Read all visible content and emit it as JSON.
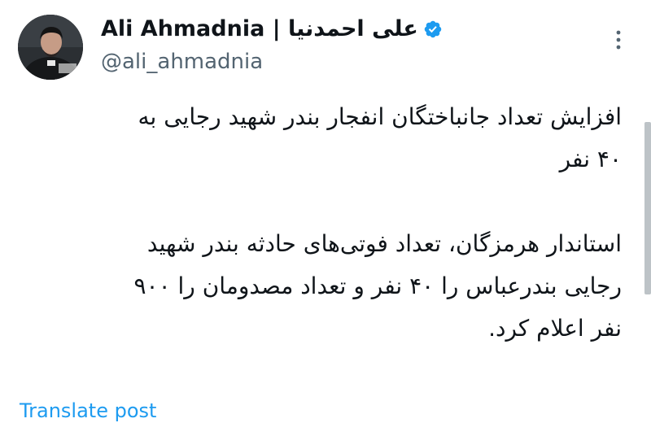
{
  "author": {
    "display_name": "Ali Ahmadnia | علی احمدنیا",
    "handle": "@ali_ahmadnia",
    "verified_color": "#1d9bf0"
  },
  "menu": {
    "more_icon": "more-vertical-icon"
  },
  "post": {
    "paragraphs": [
      {
        "lines": [
          "افزایش تعداد جانباختگان انفجار بندر شهید رجایی به",
          "۴۰ نفر"
        ]
      },
      {
        "lines": [
          "استاندار هرمزگان، تعداد فوتی‌های حادثه بندر شهید",
          "رجایی بندرعباس را ۴۰ نفر و تعداد مصدومان را ۹۰۰",
          "نفر اعلام کرد."
        ]
      }
    ]
  },
  "actions": {
    "translate_label": "Translate post"
  },
  "colors": {
    "text": "#0f1419",
    "secondary_text": "#536471",
    "link": "#1d9bf0",
    "background": "#ffffff"
  }
}
